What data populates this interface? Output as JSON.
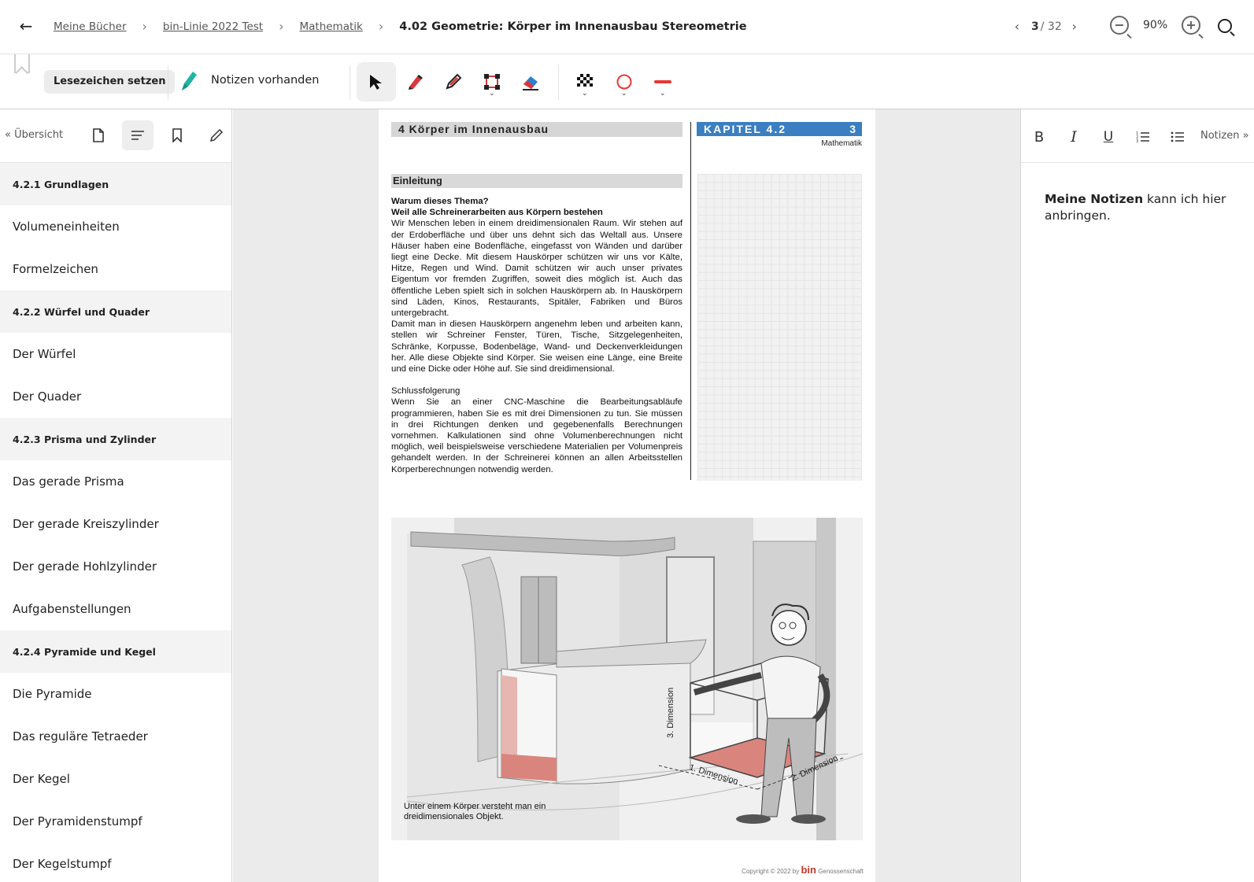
{
  "breadcrumb": {
    "items": [
      "Meine Bücher",
      "bin-Linie 2022 Test",
      "Mathematik"
    ],
    "current": "4.02 Geometrie: Körper im Innenausbau Stereometrie"
  },
  "pager": {
    "current": "3",
    "total": "/ 32"
  },
  "zoom": {
    "value": "90%"
  },
  "toolbar": {
    "bookmark_label": "Lesezeichen setzen",
    "notes_label": "Notizen vorhanden",
    "colors": {
      "pen": "#1fb5a5",
      "marker_red": "#d9383a",
      "eraser_blue": "#2b7fd4",
      "circle": "#e53935",
      "line": "#e53935"
    }
  },
  "sidebar": {
    "overview_label": "Übersicht",
    "items": [
      {
        "label": "4.2.1 Grundlagen",
        "type": "head"
      },
      {
        "label": "Volumeneinheiten",
        "type": "item"
      },
      {
        "label": "Formelzeichen",
        "type": "item"
      },
      {
        "label": "4.2.2 Würfel und Quader",
        "type": "head"
      },
      {
        "label": "Der Würfel",
        "type": "item"
      },
      {
        "label": "Der Quader",
        "type": "item"
      },
      {
        "label": "4.2.3 Prisma und Zylinder",
        "type": "head"
      },
      {
        "label": "Das gerade Prisma",
        "type": "item"
      },
      {
        "label": "Der gerade Kreiszylinder",
        "type": "item"
      },
      {
        "label": "Der gerade Hohlzylinder",
        "type": "item"
      },
      {
        "label": "Aufgabenstellungen",
        "type": "item"
      },
      {
        "label": "4.2.4 Pyramide und Kegel",
        "type": "head"
      },
      {
        "label": "Die Pyramide",
        "type": "item"
      },
      {
        "label": "Das reguläre Tetraeder",
        "type": "item"
      },
      {
        "label": "Der Kegel",
        "type": "item"
      },
      {
        "label": "Der Pyramidenstumpf",
        "type": "item"
      },
      {
        "label": "Der Kegelstumpf",
        "type": "item"
      }
    ]
  },
  "page": {
    "header_title": "4 Körper im Innenausbau",
    "chapter": "KAPITEL 4.2",
    "page_no": "3",
    "subject": "Mathematik",
    "section": "Einleitung",
    "q1": "Warum dieses Thema?",
    "q2": "Weil alle Schreinerarbeiten aus Körpern bestehen",
    "para1": "Wir Menschen leben in einem dreidimensionalen Raum. Wir stehen auf der Erdoberfläche und über uns dehnt sich das Weltall aus. Unsere Häuser haben eine Bodenfläche, eingefasst von Wänden und darüber liegt eine Decke. Mit diesem Hauskörper schützen wir uns vor Kälte, Hitze, Regen und Wind. Damit schützen wir auch unser privates Eigentum vor fremden Zugriffen, soweit dies möglich ist. Auch das öffentliche Leben spielt sich in solchen Hauskörpern ab. In Hauskörpern sind Läden, Kinos, Restaurants, Spitäler, Fabriken und Büros untergebracht.",
    "para2": "Damit man in diesen Hauskörpern angenehm leben und arbeiten kann, stellen wir Schreiner Fenster, Türen, Tische, Sitzgelegenheiten, Schränke, Korpusse, Bodenbeläge, Wand- und Deckenverkleidungen her. Alle diese Objekte sind Körper. Sie weisen eine Länge, eine Breite und eine Dicke oder Höhe auf. Sie sind dreidimensional.",
    "conclusion_title": "Schlussfolgerung",
    "para3": "Wenn Sie an einer CNC-Maschine die Bearbeitungsabläufe programmieren, haben Sie es mit drei Dimensionen zu tun. Sie müssen in drei Richtungen denken und gegebenenfalls Berechnungen vornehmen. Kalkulationen sind ohne Volumenberechnungen nicht möglich, weil beispielsweise verschiedene Materialien per Volumenpreis gehandelt werden. In der Schreinerei können an allen Arbeitsstellen Körperberechnungen notwendig werden.",
    "dim1": "1. Dimension",
    "dim2": "2. Dimension",
    "dim3": "3. Dimension",
    "caption": "Unter einem Körper versteht man ein dreidimensionales Objekt.",
    "copyright": "Copyright © 2022 by",
    "logo": "bin",
    "copyright_org": "Genossenschaft"
  },
  "notes": {
    "toggle_label": "Notizen",
    "text_bold": "Meine Notizen",
    "text_rest": " kann ich hier anbringen."
  }
}
